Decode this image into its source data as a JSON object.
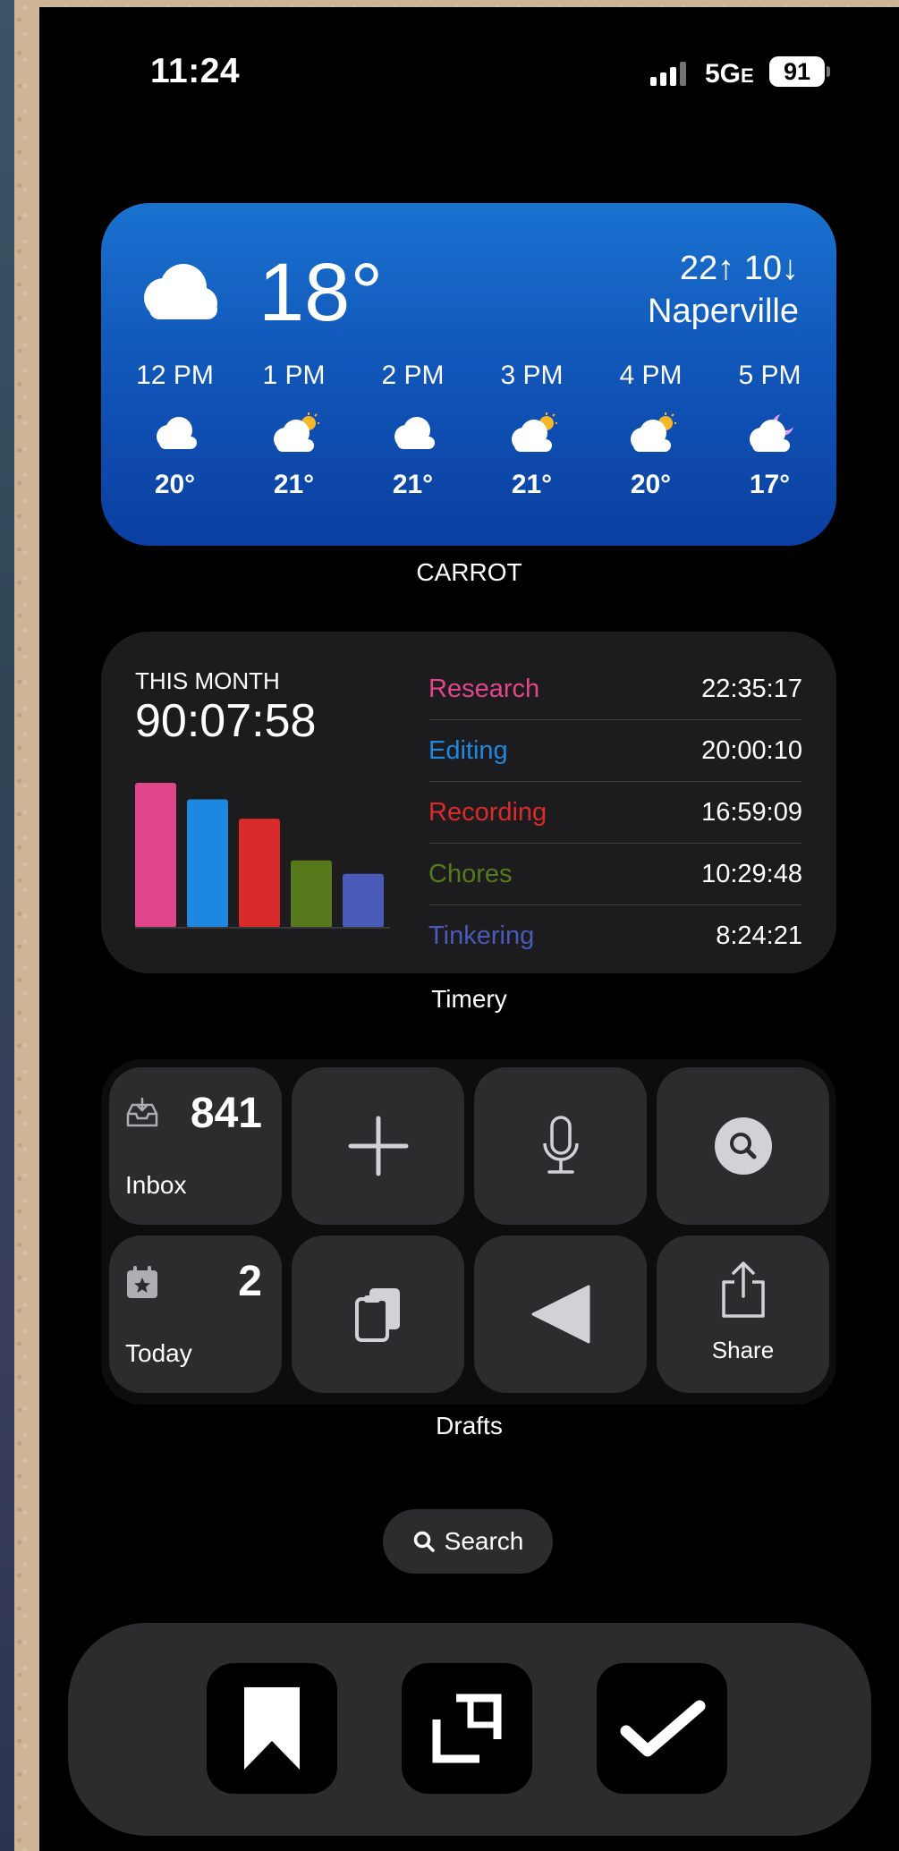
{
  "status": {
    "time": "11:24",
    "network": "5G",
    "network_suffix": "E",
    "battery": "91"
  },
  "weather": {
    "app_name": "CARROT",
    "current_temp": "18°",
    "hi_lo": "22↑ 10↓",
    "city": "Naperville",
    "hours": [
      {
        "time": "12 PM",
        "icon": "cloud-icon",
        "temp": "20°"
      },
      {
        "time": "1 PM",
        "icon": "partly-sunny-icon",
        "temp": "21°"
      },
      {
        "time": "2 PM",
        "icon": "cloud-icon",
        "temp": "21°"
      },
      {
        "time": "3 PM",
        "icon": "partly-sunny-icon",
        "temp": "21°"
      },
      {
        "time": "4 PM",
        "icon": "partly-sunny-icon",
        "temp": "20°"
      },
      {
        "time": "5 PM",
        "icon": "cloud-moon-icon",
        "temp": "17°"
      }
    ]
  },
  "timery": {
    "app_name": "Timery",
    "period_label": "THIS MONTH",
    "total": "90:07:58",
    "projects": [
      {
        "name": "Research",
        "time": "22:35:17",
        "color": "#e2468a"
      },
      {
        "name": "Editing",
        "time": "20:00:10",
        "color": "#1e88e0"
      },
      {
        "name": "Recording",
        "time": "16:59:09",
        "color": "#da2b2b"
      },
      {
        "name": "Chores",
        "time": "10:29:48",
        "color": "#567a1b"
      },
      {
        "name": "Tinkering",
        "time": "8:24:21",
        "color": "#4a5ab8"
      }
    ]
  },
  "drafts": {
    "app_name": "Drafts",
    "inbox_count": "841",
    "inbox_label": "Inbox",
    "today_count": "2",
    "today_label": "Today",
    "share_label": "Share"
  },
  "search": {
    "label": "Search"
  },
  "dock": {
    "apps": [
      "bookmark-app-icon",
      "crop-app-icon",
      "checkmark-app-icon"
    ]
  }
}
